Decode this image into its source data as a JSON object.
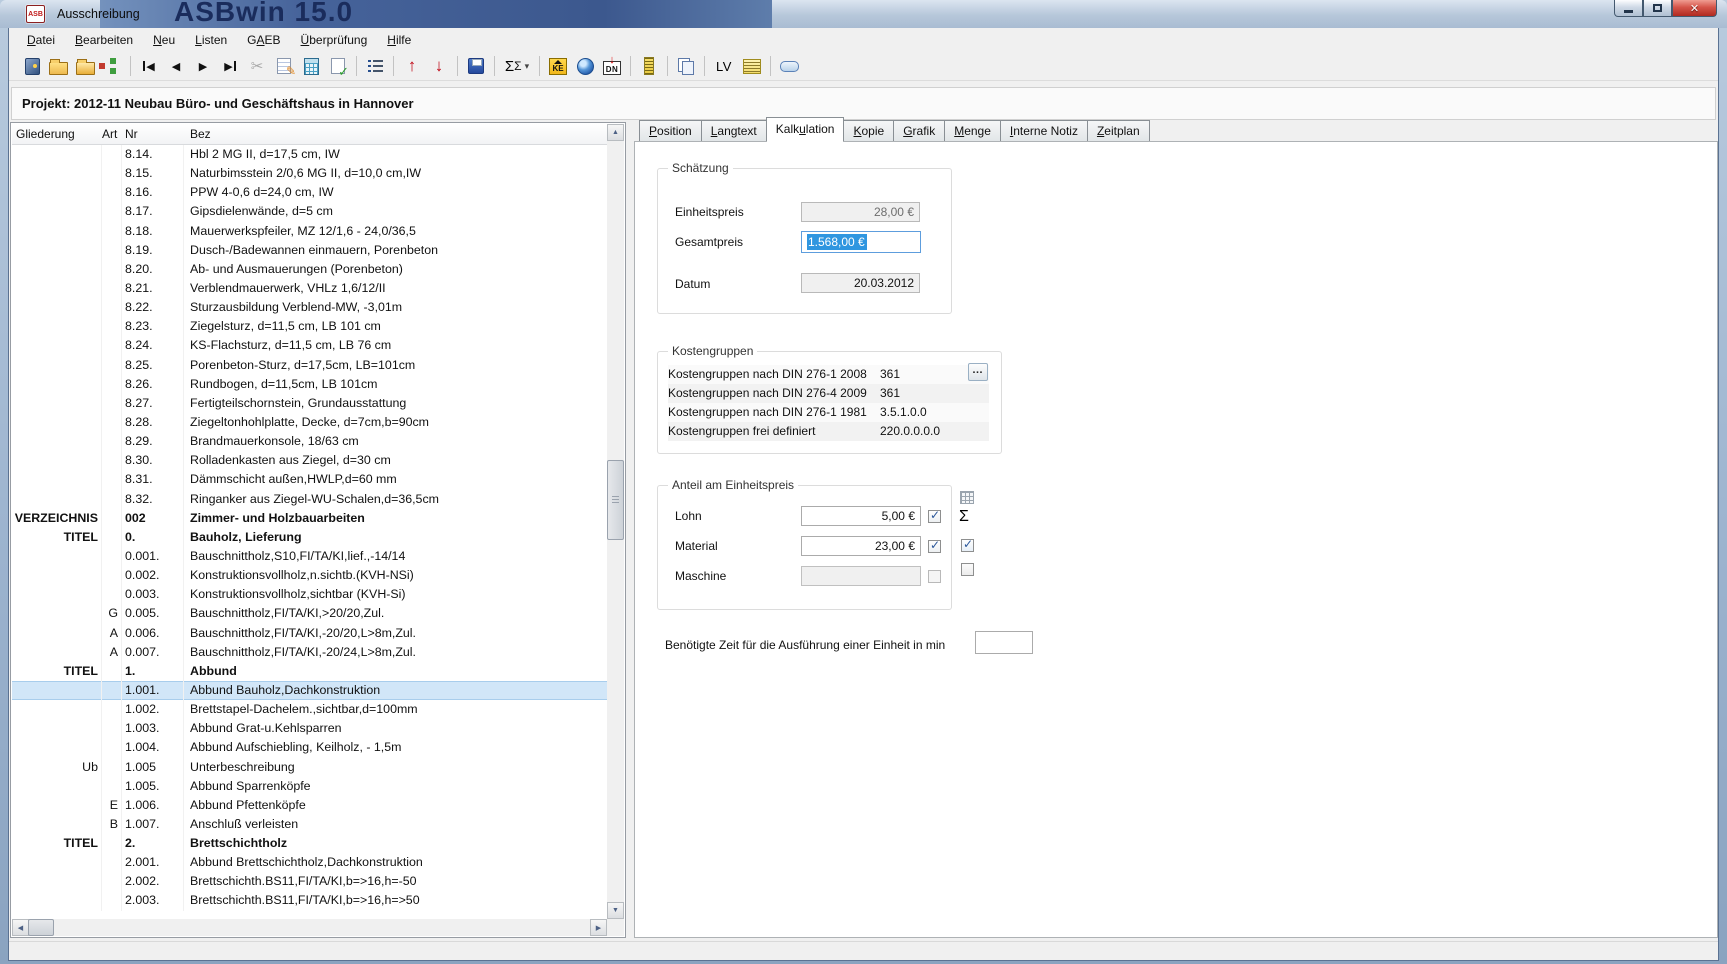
{
  "window": {
    "title": "Ausschreibung",
    "icon_text": "ASB",
    "watermark": "ASBwin 15.0"
  },
  "colors": {
    "selection_highlight": "#2f96e0",
    "selected_row": "#d1e6f8",
    "watermark_panel": "#46639a",
    "watermark_text": "#1a2c5c",
    "close_button": "#b02a20",
    "toolbar_arrow_red": "#c00715"
  },
  "menubar": {
    "items": [
      {
        "id": "datei",
        "label": "Datei",
        "u": 0
      },
      {
        "id": "bearbeiten",
        "label": "Bearbeiten",
        "u": 0
      },
      {
        "id": "neu",
        "label": "Neu",
        "u": 0
      },
      {
        "id": "listen",
        "label": "Listen",
        "u": 0
      },
      {
        "id": "gaeb",
        "label": "GAEB",
        "u": 1
      },
      {
        "id": "ueberpruefung",
        "label": "Überprüfung",
        "u": 0
      },
      {
        "id": "hilfe",
        "label": "Hilfe",
        "u": 0
      }
    ]
  },
  "toolbar": {
    "buttons": [
      {
        "name": "exit-door"
      },
      {
        "name": "folder-open"
      },
      {
        "name": "folder-open-alt"
      },
      {
        "name": "tree-structure"
      },
      {
        "name": "separator"
      },
      {
        "name": "nav-first"
      },
      {
        "name": "nav-prev"
      },
      {
        "name": "nav-next"
      },
      {
        "name": "nav-last"
      },
      {
        "name": "cut"
      },
      {
        "name": "edit-position"
      },
      {
        "name": "calculator"
      },
      {
        "name": "check-document"
      },
      {
        "name": "separator"
      },
      {
        "name": "numbered-list"
      },
      {
        "name": "separator"
      },
      {
        "name": "move-up"
      },
      {
        "name": "move-down"
      },
      {
        "name": "separator"
      },
      {
        "name": "save"
      },
      {
        "name": "separator"
      },
      {
        "name": "sum",
        "label": "Σ"
      },
      {
        "name": "separator"
      },
      {
        "name": "ke-catalog",
        "label": "KE"
      },
      {
        "name": "globe"
      },
      {
        "name": "dn-export",
        "label": "DN"
      },
      {
        "name": "separator"
      },
      {
        "name": "ruler"
      },
      {
        "name": "separator"
      },
      {
        "name": "copy"
      },
      {
        "name": "separator"
      },
      {
        "name": "lv",
        "label": "LV"
      },
      {
        "name": "notes-list"
      },
      {
        "name": "separator"
      },
      {
        "name": "oval-pill"
      }
    ]
  },
  "project": {
    "title": "Projekt: 2012-11 Neubau Büro- und Geschäftshaus in Hannover"
  },
  "tree": {
    "columns": [
      "Gliederung",
      "Art",
      "Nr",
      "Bez"
    ],
    "rows": [
      {
        "nr": "8.14.",
        "bez": "Hbl 2 MG II, d=17,5 cm, IW"
      },
      {
        "nr": "8.15.",
        "bez": "Naturbimsstein 2/0,6 MG II, d=10,0 cm,IW"
      },
      {
        "nr": "8.16.",
        "bez": "PPW 4-0,6 d=24,0 cm, IW"
      },
      {
        "nr": "8.17.",
        "bez": "Gipsdielenwände, d=5 cm"
      },
      {
        "nr": "8.18.",
        "bez": "Mauerwerkspfeiler, MZ 12/1,6 - 24,0/36,5"
      },
      {
        "nr": "8.19.",
        "bez": "Dusch-/Badewannen einmauern, Porenbeton"
      },
      {
        "nr": "8.20.",
        "bez": "Ab- und Ausmauerungen (Porenbeton)"
      },
      {
        "nr": "8.21.",
        "bez": "Verblendmauerwerk, VHLz 1,6/12/II"
      },
      {
        "nr": "8.22.",
        "bez": "Sturzausbildung Verblend-MW, -3,01m"
      },
      {
        "nr": "8.23.",
        "bez": "Ziegelsturz, d=11,5 cm, LB 101 cm"
      },
      {
        "nr": "8.24.",
        "bez": "KS-Flachsturz, d=11,5 cm, LB 76 cm"
      },
      {
        "nr": "8.25.",
        "bez": "Porenbeton-Sturz, d=17,5cm, LB=101cm"
      },
      {
        "nr": "8.26.",
        "bez": "Rundbogen, d=11,5cm, LB 101cm"
      },
      {
        "nr": "8.27.",
        "bez": "Fertigteilschornstein, Grundausstattung"
      },
      {
        "nr": "8.28.",
        "bez": "Ziegeltonhohlplatte, Decke, d=7cm,b=90cm"
      },
      {
        "nr": "8.29.",
        "bez": "Brandmauerkonsole, 18/63 cm"
      },
      {
        "nr": "8.30.",
        "bez": "Rolladenkasten aus Ziegel, d=30 cm"
      },
      {
        "nr": "8.31.",
        "bez": "Dämmschicht außen,HWLP,d=60 mm"
      },
      {
        "nr": "8.32.",
        "bez": "Ringanker aus Ziegel-WU-Schalen,d=36,5cm"
      },
      {
        "gliederung": "VERZEICHNIS",
        "nr": "002",
        "bez": "Zimmer- und Holzbauarbeiten",
        "bold": true
      },
      {
        "gliederung": "TITEL",
        "nr": "0.",
        "bez": "Bauholz, Lieferung",
        "bold": true
      },
      {
        "nr": "0.001.",
        "bez": "Bauschnittholz,S10,FI/TA/KI,lief.,-14/14"
      },
      {
        "nr": "0.002.",
        "bez": "Konstruktionsvollholz,n.sichtb.(KVH-NSi)"
      },
      {
        "nr": "0.003.",
        "bez": "Konstruktionsvollholz,sichtbar (KVH-Si)"
      },
      {
        "art": "G",
        "nr": "0.005.",
        "bez": "Bauschnittholz,FI/TA/KI,>20/20,Zul."
      },
      {
        "art": "A",
        "nr": "0.006.",
        "bez": "Bauschnittholz,FI/TA/KI,-20/20,L>8m,Zul."
      },
      {
        "art": "A",
        "nr": "0.007.",
        "bez": "Bauschnittholz,FI/TA/KI,-20/24,L>8m,Zul."
      },
      {
        "gliederung": "TITEL",
        "nr": "1.",
        "bez": "Abbund",
        "bold": true
      },
      {
        "nr": "1.001.",
        "bez": "Abbund Bauholz,Dachkonstruktion",
        "selected": true
      },
      {
        "nr": "1.002.",
        "bez": "Brettstapel-Dachelem.,sichtbar,d=100mm"
      },
      {
        "nr": "1.003.",
        "bez": "Abbund Grat-u.Kehlsparren"
      },
      {
        "nr": "1.004.",
        "bez": "Abbund Aufschiebling, Keilholz, - 1,5m"
      },
      {
        "gliederung": "Ub",
        "nr": "1.005",
        "bez": "Unterbeschreibung"
      },
      {
        "nr": "1.005.",
        "bez": "Abbund Sparrenköpfe"
      },
      {
        "art": "E",
        "nr": "1.006.",
        "bez": "Abbund Pfettenköpfe"
      },
      {
        "art": "B",
        "nr": "1.007.",
        "bez": "Anschluß verleisten"
      },
      {
        "gliederung": "TITEL",
        "nr": "2.",
        "bez": "Brettschichtholz",
        "bold": true
      },
      {
        "nr": "2.001.",
        "bez": "Abbund Brettschichtholz,Dachkonstruktion"
      },
      {
        "nr": "2.002.",
        "bez": "Brettschichth.BS11,FI/TA/KI,b=>16,h=-50"
      },
      {
        "nr": "2.003.",
        "bez": "Brettschichth.BS11,FI/TA/KI,b=>16,h=>50"
      }
    ]
  },
  "tabs": [
    {
      "id": "position",
      "label": "Position",
      "u": 0
    },
    {
      "id": "langtext",
      "label": "Langtext",
      "u": 0
    },
    {
      "id": "kalkulation",
      "label": "Kalkulation",
      "u": 4,
      "active": true
    },
    {
      "id": "kopie",
      "label": "Kopie",
      "u": 0
    },
    {
      "id": "grafik",
      "label": "Grafik",
      "u": 0
    },
    {
      "id": "menge",
      "label": "Menge",
      "u": 0
    },
    {
      "id": "interne-not iz",
      "label": "Interne Notiz",
      "u": 0
    },
    {
      "id": "zeitplan",
      "label": "Zeitplan",
      "u": 0
    }
  ],
  "kalkulation": {
    "schaetzung": {
      "legend": "Schätzung",
      "einheitspreis_label": "Einheitspreis",
      "einheitspreis_value": "28,00 €",
      "gesamtpreis_label": "Gesamtpreis",
      "gesamtpreis_value": "1.568,00 €",
      "datum_label": "Datum",
      "datum_value": "20.03.2012"
    },
    "kostengruppen": {
      "legend": "Kostengruppen",
      "more_button": "…",
      "rows": [
        {
          "label": "Kostengruppen nach DIN 276-1 2008",
          "value": "361"
        },
        {
          "label": "Kostengruppen nach DIN 276-4 2009",
          "value": "361"
        },
        {
          "label": "Kostengruppen nach DIN 276-1 1981",
          "value": "3.5.1.0.0"
        },
        {
          "label": "Kostengruppen frei definiert",
          "value": "220.0.0.0.0"
        }
      ]
    },
    "anteil": {
      "legend": "Anteil am Einheitspreis",
      "rows": [
        {
          "label": "Lohn",
          "value": "5,00 €",
          "checked": true
        },
        {
          "label": "Material",
          "value": "23,00 €",
          "checked": true
        },
        {
          "label": "Maschine",
          "value": "",
          "disabled": true
        }
      ]
    },
    "zeit": {
      "label": "Benötigte Zeit für die Ausführung einer Einheit in min",
      "value": ""
    }
  }
}
